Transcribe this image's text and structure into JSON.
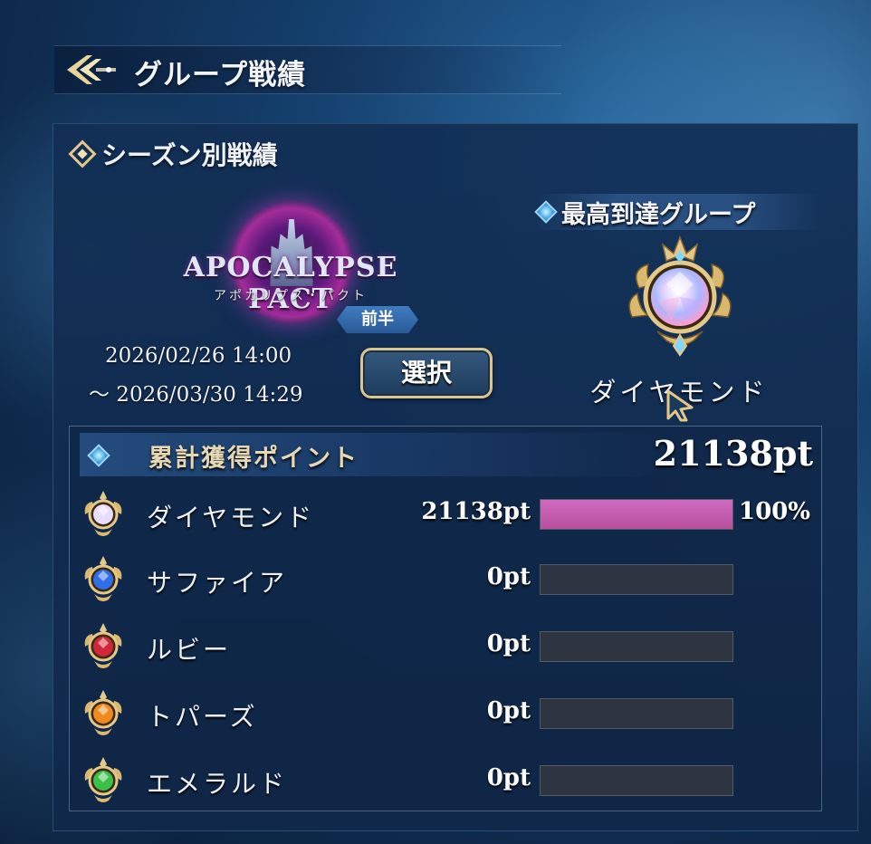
{
  "header": {
    "title": "グループ戦績",
    "back_icon": "back-arrow-icon"
  },
  "season_section": {
    "heading": "シーズン別戦績",
    "logo": {
      "title": "APOCALYPSE PACT",
      "subtitle": "アポカリプス・パクト",
      "half_badge": "前半"
    },
    "period_start": "2026/02/26 14:00",
    "period_end": "～ 2026/03/30 14:29",
    "select_label": "選択"
  },
  "highest_group": {
    "heading": "最高到達グループ",
    "name": "ダイヤモンド",
    "icon": "diamond-emblem-icon"
  },
  "points": {
    "heading": "累計獲得ポイント",
    "total": "21138pt",
    "rows": [
      {
        "name": "ダイヤモンド",
        "pts": "21138pt",
        "percent": 100,
        "percent_label": "100%",
        "icon": "diamond-emblem-icon",
        "gem_color": "#e8dcff"
      },
      {
        "name": "サファイア",
        "pts": "0pt",
        "percent": 0,
        "percent_label": "",
        "icon": "sapphire-emblem-icon",
        "gem_color": "#2f6ee8"
      },
      {
        "name": "ルビー",
        "pts": "0pt",
        "percent": 0,
        "percent_label": "",
        "icon": "ruby-emblem-icon",
        "gem_color": "#d0283a"
      },
      {
        "name": "トパーズ",
        "pts": "0pt",
        "percent": 0,
        "percent_label": "",
        "icon": "topaz-emblem-icon",
        "gem_color": "#f08a1e"
      },
      {
        "name": "エメラルド",
        "pts": "0pt",
        "percent": 0,
        "percent_label": "",
        "icon": "emerald-emblem-icon",
        "gem_color": "#3cc04a"
      }
    ]
  },
  "colors": {
    "gold": "#e3c88a",
    "bar_fill": "#c05ca8",
    "bar_empty": "#2e3440"
  }
}
